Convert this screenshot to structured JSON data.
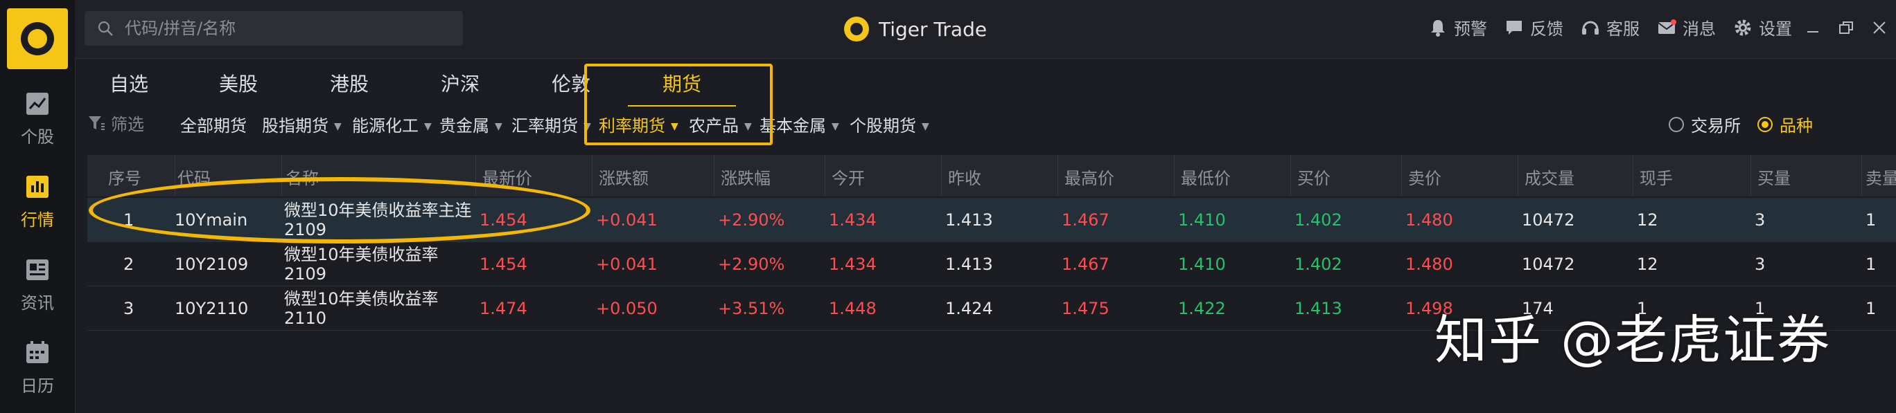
{
  "app": {
    "title": "Tiger Trade"
  },
  "search": {
    "placeholder": "代码/拼音/名称"
  },
  "sidebar": {
    "items": [
      {
        "label": "个股",
        "icon": "chart-icon"
      },
      {
        "label": "行情",
        "icon": "market-icon"
      },
      {
        "label": "资讯",
        "icon": "news-icon"
      },
      {
        "label": "日历",
        "icon": "calendar-icon"
      }
    ]
  },
  "top_actions": [
    {
      "label": "预警",
      "icon": "bell-icon"
    },
    {
      "label": "反馈",
      "icon": "chat-icon"
    },
    {
      "label": "客服",
      "icon": "headset-icon"
    },
    {
      "label": "消息",
      "icon": "mail-icon"
    },
    {
      "label": "设置",
      "icon": "gear-icon"
    }
  ],
  "tabs": [
    "自选",
    "美股",
    "港股",
    "沪深",
    "伦敦",
    "期货"
  ],
  "filters": {
    "label": "筛选",
    "items": [
      "全部期货",
      "股指期货",
      "能源化工",
      "贵金属",
      "汇率期货",
      "利率期货",
      "农产品",
      "基本金属",
      "个股期货"
    ],
    "radios": [
      "交易所",
      "品种"
    ]
  },
  "table": {
    "headers": [
      "序号",
      "代码",
      "名称",
      "最新价",
      "涨跌额",
      "涨跌幅",
      "今开",
      "昨收",
      "最高价",
      "最低价",
      "买价",
      "卖价",
      "成交量",
      "现手",
      "买量",
      "卖量"
    ],
    "rows": [
      {
        "no": "1",
        "code": "10Ymain",
        "name1": "微型10年美债收益率主连",
        "name2": "2109",
        "last": "1.454",
        "chg": "+0.041",
        "pct": "+2.90%",
        "open": "1.434",
        "prev": "1.413",
        "high": "1.467",
        "low": "1.410",
        "bid": "1.402",
        "ask": "1.480",
        "vol": "10472",
        "cur": "12",
        "bidq": "3",
        "askq": "1"
      },
      {
        "no": "2",
        "code": "10Y2109",
        "name1": "微型10年美债收益率",
        "name2": "2109",
        "last": "1.454",
        "chg": "+0.041",
        "pct": "+2.90%",
        "open": "1.434",
        "prev": "1.413",
        "high": "1.467",
        "low": "1.410",
        "bid": "1.402",
        "ask": "1.480",
        "vol": "10472",
        "cur": "12",
        "bidq": "3",
        "askq": "1"
      },
      {
        "no": "3",
        "code": "10Y2110",
        "name1": "微型10年美债收益率",
        "name2": "2110",
        "last": "1.474",
        "chg": "+0.050",
        "pct": "+3.51%",
        "open": "1.448",
        "prev": "1.424",
        "high": "1.475",
        "low": "1.422",
        "bid": "1.413",
        "ask": "1.498",
        "vol": "174",
        "cur": "1",
        "bidq": "1",
        "askq": "1"
      }
    ]
  },
  "watermark": "知乎 @老虎证券",
  "colors": {
    "accent": "#f5c518",
    "up": "#ff4d4f",
    "down": "#26c26b",
    "annotation": "#f5b800"
  }
}
